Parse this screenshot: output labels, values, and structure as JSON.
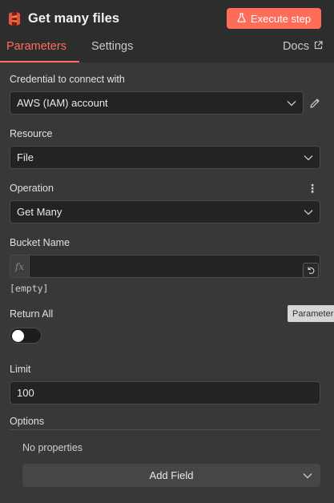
{
  "header": {
    "title": "Get many files",
    "execute_label": "Execute step"
  },
  "tabs": [
    {
      "label": "Parameters",
      "active": true
    },
    {
      "label": "Settings",
      "active": false
    }
  ],
  "docs_label": "Docs",
  "fields": {
    "credential": {
      "label": "Credential to connect with",
      "value": "AWS (IAM) account"
    },
    "resource": {
      "label": "Resource",
      "value": "File"
    },
    "operation": {
      "label": "Operation",
      "value": "Get Many"
    },
    "bucket": {
      "label": "Bucket Name",
      "value": "",
      "hint": "[empty]"
    },
    "return_all": {
      "label": "Return All",
      "on": false
    },
    "limit": {
      "label": "Limit",
      "value": "100"
    },
    "options": {
      "label": "Options",
      "empty_text": "No properties",
      "add_label": "Add Field"
    }
  },
  "tooltip": "Parameter",
  "colors": {
    "accent": "#ff6d5a",
    "panel": "#38383a",
    "header": "#2d2d2e",
    "input": "#232324"
  },
  "icons": {
    "node": "aws-s3-icon",
    "execute": "flask-icon",
    "docs": "external-link-icon",
    "edit": "pencil-icon",
    "dropdown": "chevron-down-icon",
    "reset": "reset-icon",
    "menu": "vertical-dots-icon"
  }
}
